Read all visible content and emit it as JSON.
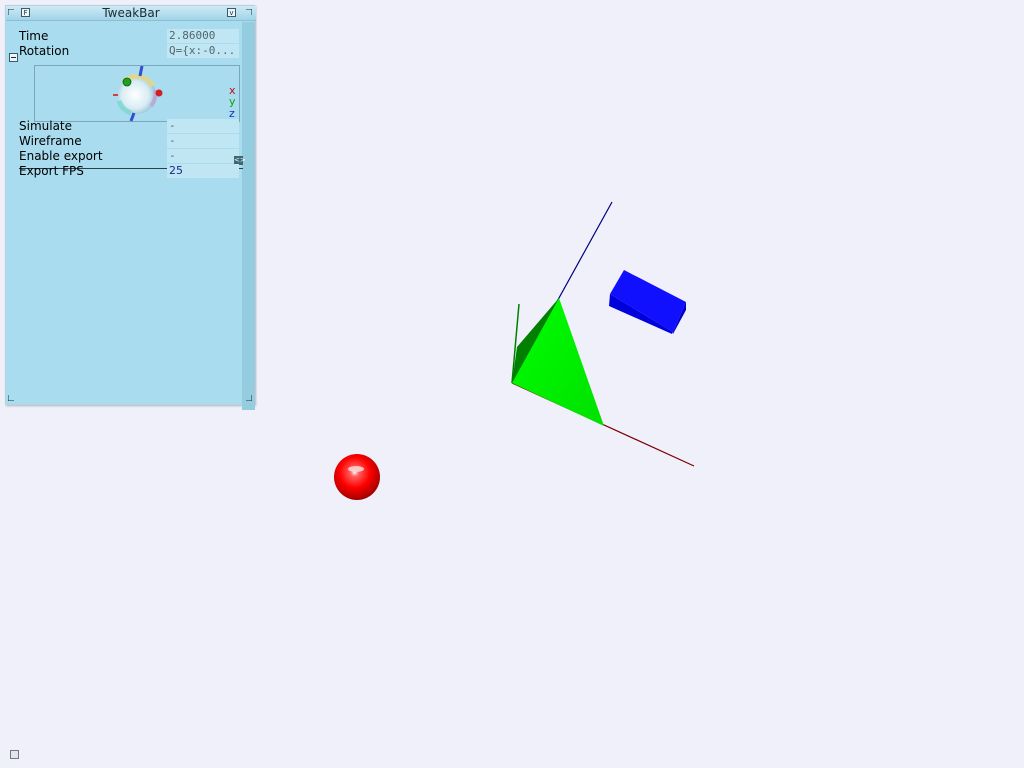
{
  "tweakbar": {
    "title": "TweakBar",
    "help_button": "F",
    "minimize_button": "v",
    "rows": {
      "time": {
        "label": "Time",
        "value": "2.86000"
      },
      "rotation": {
        "label": "Rotation",
        "value": "Q={x:-0..."
      },
      "simulate": {
        "label": "Simulate",
        "value": "-"
      },
      "wireframe": {
        "label": "Wireframe",
        "value": "-"
      },
      "enable_export": {
        "label": "Enable export",
        "value": "-"
      },
      "export_fps": {
        "label": "Export FPS",
        "value": "25"
      }
    },
    "axis_legend": {
      "x": "x",
      "y": "y",
      "z": "z"
    },
    "spin_button": "<>"
  },
  "colors": {
    "background": "#f0f0fb",
    "panel": "#a8dcee",
    "axis_x": "#7a0000",
    "axis_y": "#008000",
    "axis_z": "#000080",
    "pyramid_bright": "#00ff00",
    "pyramid_dark": "#007f00",
    "box": "#0000ff",
    "sphere": "#ff0000"
  },
  "icons": {
    "status": "window-icon",
    "rotation_gizmo": "arcball-sphere-icon"
  }
}
